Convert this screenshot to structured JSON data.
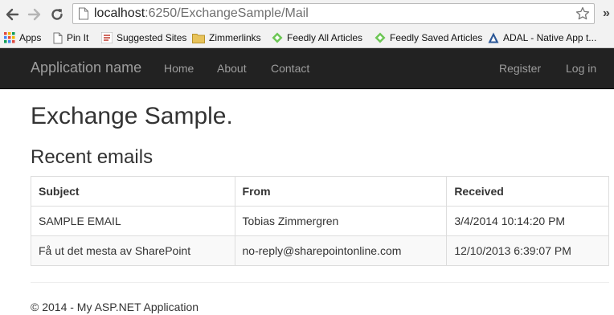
{
  "browser": {
    "url_host": "localhost",
    "url_rest": ":6250/ExchangeSample/Mail",
    "bookmarks": [
      {
        "label": "Apps",
        "icon": "apps-grid-icon"
      },
      {
        "label": "Pin It",
        "icon": "page-icon"
      },
      {
        "label": "Suggested Sites",
        "icon": "suggested-sites-icon"
      },
      {
        "label": "Zimmerlinks",
        "icon": "folder-icon"
      },
      {
        "label": "Feedly All Articles",
        "icon": "feedly-icon"
      },
      {
        "label": "Feedly Saved Articles",
        "icon": "feedly-icon"
      },
      {
        "label": "ADAL - Native App t...",
        "icon": "adal-icon"
      }
    ],
    "overflow_label": "»",
    "accent_colors": {
      "feedly": "#6cc655",
      "folder": "#e8c35a",
      "navbar": "#222222"
    }
  },
  "navbar": {
    "brand": "Application name",
    "left_links": [
      "Home",
      "About",
      "Contact"
    ],
    "right_links": [
      "Register",
      "Log in"
    ]
  },
  "main": {
    "title": "Exchange Sample.",
    "subtitle": "Recent emails",
    "table": {
      "headers": [
        "Subject",
        "From",
        "Received"
      ],
      "rows": [
        [
          "SAMPLE EMAIL",
          "Tobias Zimmergren",
          "3/4/2014 10:14:20 PM"
        ],
        [
          "Få ut det mesta av SharePoint",
          "no-reply@sharepointonline.com",
          "12/10/2013 6:39:07 PM"
        ]
      ]
    }
  },
  "footer": {
    "text": "© 2014 - My ASP.NET Application"
  }
}
